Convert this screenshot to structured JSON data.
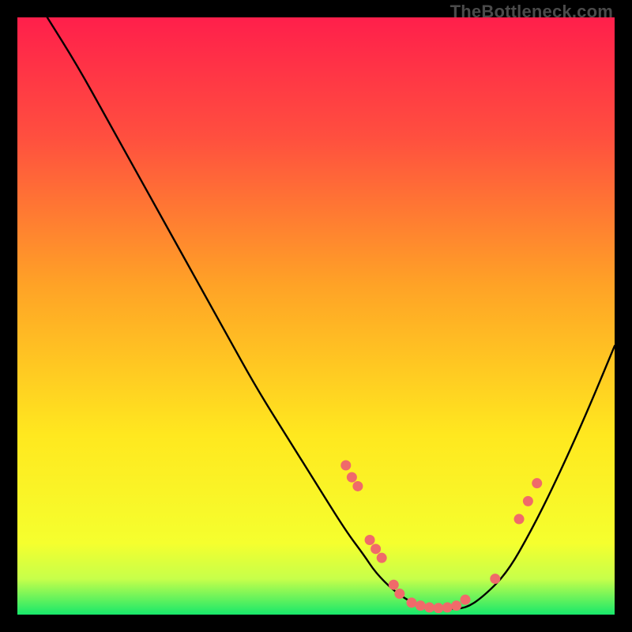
{
  "watermark": {
    "text": "TheBottleneck.com"
  },
  "chart_data": {
    "type": "line",
    "title": "",
    "xlabel": "",
    "ylabel": "",
    "xlim": [
      0,
      100
    ],
    "ylim": [
      0,
      100
    ],
    "grid": false,
    "legend": false,
    "background_gradient": {
      "stops": [
        {
          "offset": 0.0,
          "color": "#ff1f4b"
        },
        {
          "offset": 0.2,
          "color": "#ff4f3f"
        },
        {
          "offset": 0.45,
          "color": "#ffa326"
        },
        {
          "offset": 0.7,
          "color": "#ffe81f"
        },
        {
          "offset": 0.88,
          "color": "#f5ff2e"
        },
        {
          "offset": 0.94,
          "color": "#c7ff4a"
        },
        {
          "offset": 1.0,
          "color": "#17e86b"
        }
      ]
    },
    "series": [
      {
        "name": "bottleneck-curve",
        "color": "#000000",
        "x": [
          5,
          10,
          15,
          20,
          25,
          30,
          35,
          40,
          45,
          50,
          55,
          58,
          60,
          63,
          66,
          69,
          72,
          75,
          78,
          82,
          86,
          90,
          95,
          100
        ],
        "y": [
          100,
          92,
          83,
          74,
          65,
          56,
          47,
          38,
          30,
          22,
          14,
          10,
          7,
          4,
          2,
          1,
          1,
          1,
          3,
          7,
          14,
          22,
          33,
          45
        ]
      }
    ],
    "markers": {
      "color": "#f06a6a",
      "points": [
        {
          "x": 55.0,
          "y": 25.0
        },
        {
          "x": 56.0,
          "y": 23.0
        },
        {
          "x": 57.0,
          "y": 21.5
        },
        {
          "x": 59.0,
          "y": 12.5
        },
        {
          "x": 60.0,
          "y": 11.0
        },
        {
          "x": 61.0,
          "y": 9.5
        },
        {
          "x": 63.0,
          "y": 5.0
        },
        {
          "x": 64.0,
          "y": 3.5
        },
        {
          "x": 66.0,
          "y": 2.0
        },
        {
          "x": 67.5,
          "y": 1.5
        },
        {
          "x": 69.0,
          "y": 1.2
        },
        {
          "x": 70.5,
          "y": 1.1
        },
        {
          "x": 72.0,
          "y": 1.2
        },
        {
          "x": 73.5,
          "y": 1.5
        },
        {
          "x": 75.0,
          "y": 2.5
        },
        {
          "x": 80.0,
          "y": 6.0
        },
        {
          "x": 84.0,
          "y": 16.0
        },
        {
          "x": 85.5,
          "y": 19.0
        },
        {
          "x": 87.0,
          "y": 22.0
        }
      ]
    }
  }
}
